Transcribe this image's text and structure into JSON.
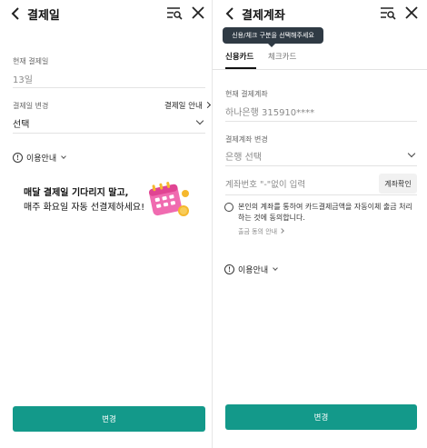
{
  "left": {
    "title": "결제일",
    "current_label": "현재 결제일",
    "current_value": "13일",
    "change_label": "결제일 변경",
    "guide_link": "결제일 안내",
    "select_value": "선택",
    "info_label": "이용안내",
    "promo_line1": "매달 결제일 기다리지 말고,",
    "promo_line2": "매주 화요일 자동 선결제하세요!",
    "button_label": "변경"
  },
  "right": {
    "title": "결제계좌",
    "tooltip": "신용/체크 구분을 선택해주세요",
    "tabs": [
      {
        "label": "신용카드",
        "active": true
      },
      {
        "label": "체크카드",
        "active": false
      }
    ],
    "current_label": "현재 결제계좌",
    "current_value": "하나은행 315910****",
    "change_label": "결제계좌 변경",
    "bank_placeholder": "은행 선택",
    "account_placeholder": "계좌번호 \"-\"없이 입력",
    "verify_button": "계좌확인",
    "agree_text": "본인의 계좌를 통하여 카드결제금액을 자동이체 출금 처리하는 것에 동의합니다.",
    "guide_link": "출금 동의 안내",
    "info_label": "이용안내",
    "button_label": "변경"
  },
  "colors": {
    "accent": "#13998a",
    "tooltip_bg": "#2f3a44",
    "calendar_pink": "#f06bb0",
    "coin_gold": "#f5b82e"
  },
  "icons": [
    "back-icon",
    "menu-search-icon",
    "close-icon",
    "info-icon",
    "chevron-down-icon",
    "chevron-right-icon",
    "calendar-icon"
  ]
}
